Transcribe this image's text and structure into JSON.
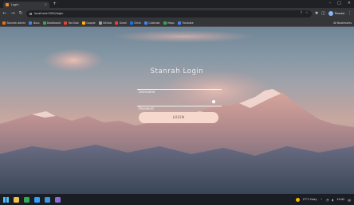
{
  "browser": {
    "tab_title": "Login",
    "new_tab": "+",
    "window_controls": [
      "–",
      "□",
      "✕"
    ],
    "url": "localhost:5000/login",
    "profile_label": "Paused"
  },
  "bookmarks": [
    {
      "label": "Stanrah Admin",
      "color": "#e8710a"
    },
    {
      "label": "Docs",
      "color": "#4285f4"
    },
    {
      "label": "Dashboard",
      "color": "#34a853"
    },
    {
      "label": "YouTube",
      "color": "#ea4335"
    },
    {
      "label": "Google",
      "color": "#fbbc04"
    },
    {
      "label": "GitHub",
      "color": "#9aa0a6"
    },
    {
      "label": "Gmail",
      "color": "#ea4335"
    },
    {
      "label": "Drive",
      "color": "#1a73e8"
    },
    {
      "label": "Calendar",
      "color": "#4285f4"
    },
    {
      "label": "Maps",
      "color": "#34a853"
    },
    {
      "label": "Translate",
      "color": "#4285f4"
    }
  ],
  "bookmarks_right": [
    "All Bookmarks"
  ],
  "login": {
    "title": "Stanrah Login",
    "username_placeholder": "Username",
    "password_placeholder": "Password",
    "button_label": "LOGIN"
  },
  "taskbar": {
    "weather": "27°C Hazy",
    "time": "10:42",
    "icons": [
      {
        "name": "file-explorer-icon",
        "color": "#f0c24a"
      },
      {
        "name": "chrome-icon",
        "color": "#34a853"
      },
      {
        "name": "edge-icon",
        "color": "#2ea0ff"
      },
      {
        "name": "vscode-icon",
        "color": "#3a96dd"
      },
      {
        "name": "store-icon",
        "color": "#8a6bd6"
      }
    ]
  },
  "colors": {
    "accent_button": "#f6d8cd",
    "sky_top": "#6f8597",
    "cloud_pink": "#e6b2a8"
  }
}
